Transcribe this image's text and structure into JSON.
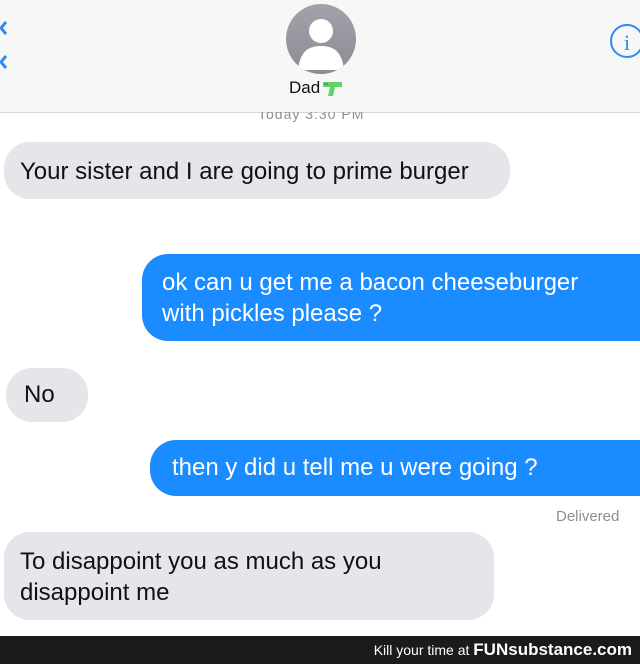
{
  "header": {
    "contact_name": "Dad",
    "name_emoji_icon": "water-pistol-icon",
    "info_label": "i",
    "timestamp": "Today 3:30 PM"
  },
  "messages": [
    {
      "from": "Dad",
      "text": "Your sister and I are going to prime burger"
    },
    {
      "from": "me",
      "text": "ok can u get me a bacon cheeseburger with pickles please ?"
    },
    {
      "from": "Dad",
      "text": "No"
    },
    {
      "from": "me",
      "text": "then y did u tell me u were going ?"
    },
    {
      "from": "Dad",
      "text": "To disappoint you as much as you disappoint me"
    }
  ],
  "status": {
    "delivered": "Delivered"
  },
  "footer": {
    "text": "Kill your time at",
    "brand": "FUNsubstance.com"
  },
  "colors": {
    "incoming_bubble": "#e5e5ea",
    "outgoing_bubble": "#1a8cff",
    "accent": "#2d8cf0"
  }
}
